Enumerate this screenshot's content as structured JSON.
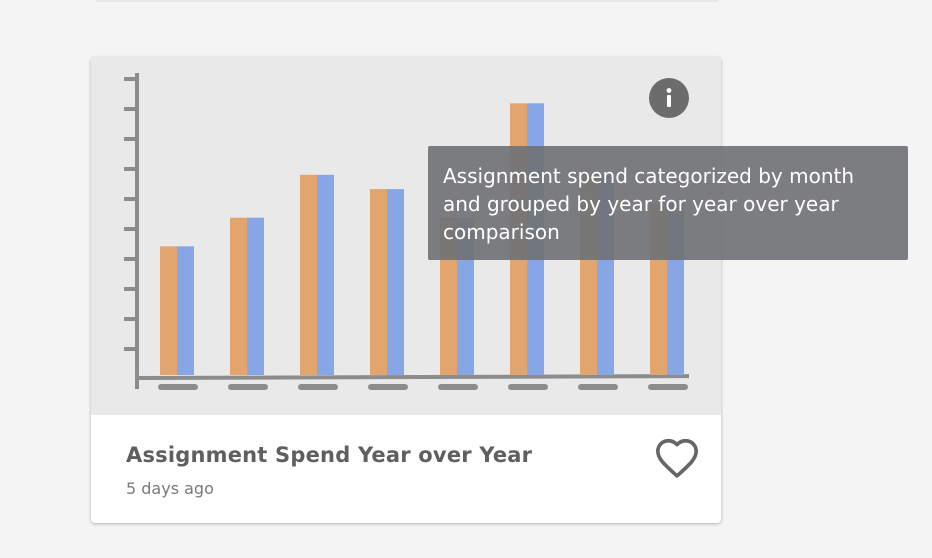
{
  "card": {
    "title": "Assignment Spend Year over Year",
    "subtitle": "5 days ago",
    "tooltip": "Assignment spend categorized by month and grouped by year for year over year comparison"
  },
  "icons": {
    "info": "info-icon",
    "favorite": "heart-outline-icon"
  },
  "thumbnail_chart": {
    "type": "bar",
    "bar_count": 8,
    "levels": [
      0.45,
      0.55,
      0.7,
      0.65,
      0.55,
      0.95,
      0.7,
      0.6
    ],
    "series_colors": [
      "#e2a56e",
      "#86a6e6"
    ]
  },
  "colors": {
    "info_button": "#6c6c6c",
    "axis": "#8c8c8c",
    "tooltip_bg": "#707276"
  }
}
